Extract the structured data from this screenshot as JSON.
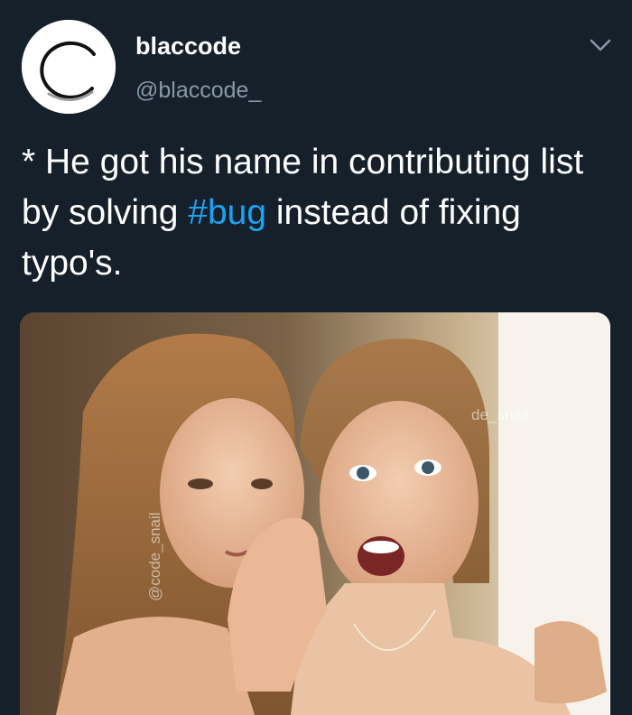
{
  "author": {
    "display_name": "blaccode",
    "handle": "@blaccode_"
  },
  "tweet": {
    "text_before": "* He got his name in contributing list by solving ",
    "hashtag": "#bug",
    "text_after": " instead of fixing typo's."
  },
  "media": {
    "watermark_top": "de_snail",
    "watermark_side": "@code_snail"
  },
  "colors": {
    "background": "#15202b",
    "text": "#ffffff",
    "secondary_text": "#8899a6",
    "hashtag": "#1da1f2"
  },
  "icons": {
    "avatar": "c-logo-icon",
    "menu": "chevron-down-icon"
  }
}
